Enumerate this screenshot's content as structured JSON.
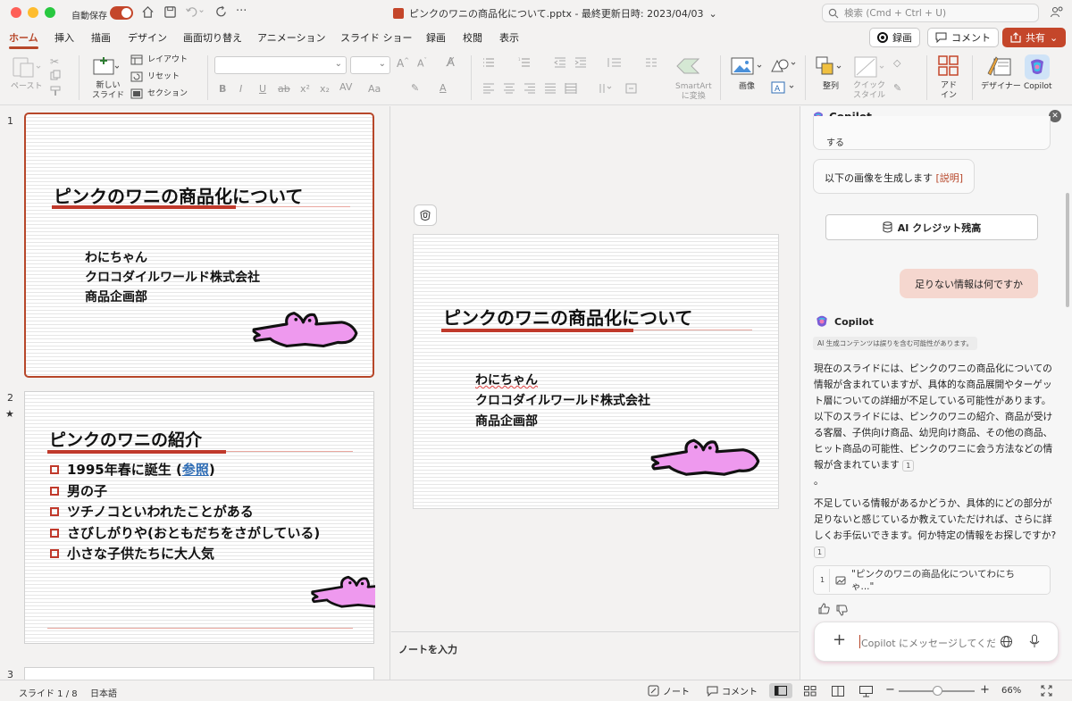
{
  "window": {
    "autosave_label": "自動保存",
    "doc_title": "ピンクのワニの商品化について.pptx - 最終更新日時: 2023/04/03",
    "search_placeholder": "検索 (Cmd + Ctrl + U)"
  },
  "tabs": [
    "ホーム",
    "挿入",
    "描画",
    "デザイン",
    "画面切り替え",
    "アニメーション",
    "スライド ショー",
    "録画",
    "校閲",
    "表示"
  ],
  "active_tab": "ホーム",
  "header_buttons": {
    "record": "録画",
    "comment": "コメント",
    "share": "共有"
  },
  "ribbon": {
    "paste": "ペースト",
    "new_slide": "新しい\nスライド",
    "layout": "レイアウト",
    "reset": "リセット",
    "section": "セクション",
    "smartart": "SmartArt\nに変換",
    "picture": "画像",
    "arrange": "整列",
    "quick_styles": "クイック\nスタイル",
    "addins": "アド\nイン",
    "designer": "デザイナー",
    "copilot": "Copilot"
  },
  "slide1": {
    "number": "1",
    "title": "ピンクのワニの商品化について",
    "lines": [
      "わにちゃん",
      "クロコダイルワールド株式会社",
      "商品企画部"
    ]
  },
  "slide2": {
    "number": "2",
    "star": "★",
    "title": "ピンクのワニの紹介",
    "bullets": [
      {
        "pre": "1995年春に誕生 (",
        "link": "参照",
        "post": ")"
      },
      {
        "text": "男の子"
      },
      {
        "text": "ツチノコといわれたことがある"
      },
      {
        "text": "さびしがりや(おともだちをさがしている)"
      },
      {
        "text": "小さな子供たちに大人気"
      }
    ]
  },
  "slide3": {
    "number": "3"
  },
  "notes_placeholder": "ノートを入力",
  "copilot": {
    "title": "Copilot",
    "partial_text": "する",
    "generate_text": "以下の画像を生成します",
    "generate_link": "[説明]",
    "credits_button": "AI クレジット残高",
    "user_message": "足りない情報は何ですか",
    "assistant_name": "Copilot",
    "disclaimer": "AI 生成コンテンツは誤りを含む可能性があります。",
    "para1": "現在のスライドには、ピンクのワニの商品化についての情報が含まれていますが、具体的な商品展開やターゲット層についての詳細が不足している可能性があります。以下のスライドには、ピンクのワニの紹介、商品が受ける客層、子供向け商品、幼児向け商品、その他の商品、ヒット商品の可能性、ピンクのワニに会う方法などの情報が含まれています",
    "para1_end": "。",
    "para2": "不足している情報があるかどうか、具体的にどの部分が足りないと感じているか教えていただければ、さらに詳しくお手伝いできます。何か特定の情報をお探しですか?",
    "cite": "1",
    "reference_number": "1",
    "reference_text": "\"ピンクのワニの商品化についてわにちゃ...\"",
    "input_placeholder": "Copilot にメッセージしてくだ"
  },
  "status": {
    "slide_pos": "スライド 1 / 8",
    "language": "日本語",
    "notes": "ノート",
    "comments": "コメント",
    "zoom": "66%"
  },
  "zoom_level": 0.66,
  "colors": {
    "accent": "#b7472a",
    "share": "#c4462a",
    "croc_pink": "#ee99ee",
    "underline_red": "#c0392b"
  }
}
